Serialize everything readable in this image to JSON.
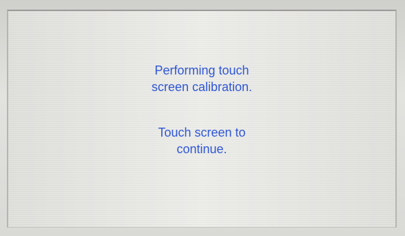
{
  "screen": {
    "calibration_message": {
      "line1": "Performing touch",
      "line2": "screen calibration."
    },
    "prompt_message": {
      "line1": "Touch screen to",
      "line2": "continue."
    }
  },
  "colors": {
    "text": "#2f57d6",
    "screen_background": "#ededea"
  }
}
